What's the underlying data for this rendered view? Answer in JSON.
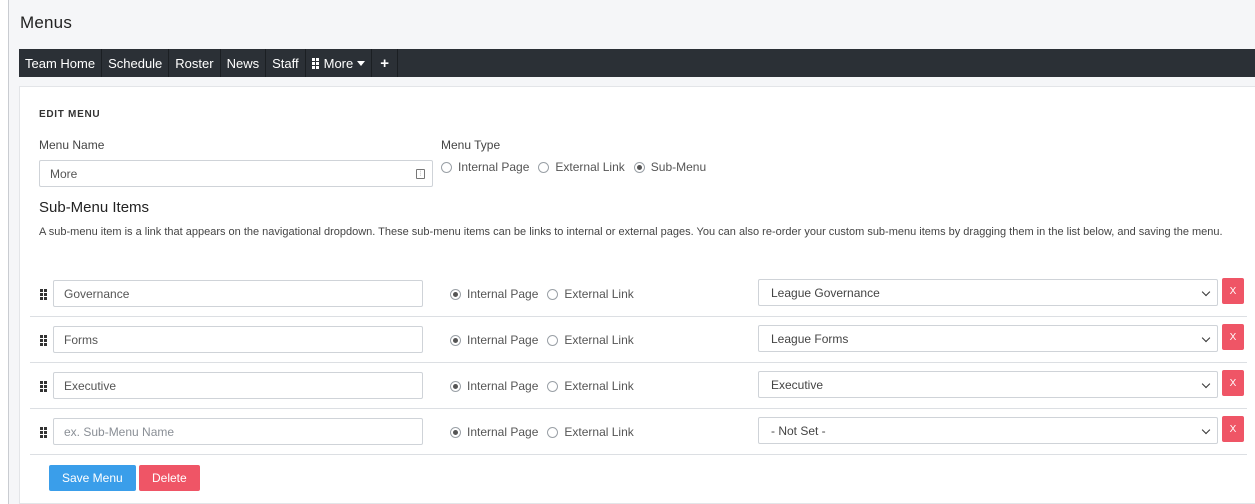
{
  "page_title": "Menus",
  "nav": {
    "items": [
      "Team Home",
      "Schedule",
      "Roster",
      "News",
      "Staff"
    ],
    "more_label": "More",
    "add_label": "+"
  },
  "edit": {
    "section_title": "EDIT MENU",
    "menu_name_label": "Menu Name",
    "menu_name_value": "More",
    "menu_type_label": "Menu Type",
    "type_options": [
      "Internal Page",
      "External Link",
      "Sub-Menu"
    ],
    "selected_type": "Sub-Menu"
  },
  "submenu": {
    "title": "Sub-Menu Items",
    "description": "A sub-menu item is a link that appears on the navigational dropdown. These sub-menu items can be links to internal or external pages. You can also re-order your custom sub-menu items by dragging them in the list below, and saving the menu.",
    "link_options": [
      "Internal Page",
      "External Link"
    ],
    "remove_label": "X",
    "items": [
      {
        "name": "Governance",
        "placeholder": "",
        "link_type": "Internal Page",
        "page": "League Governance"
      },
      {
        "name": "Forms",
        "placeholder": "",
        "link_type": "Internal Page",
        "page": "League Forms"
      },
      {
        "name": "Executive",
        "placeholder": "",
        "link_type": "Internal Page",
        "page": "Executive"
      },
      {
        "name": "",
        "placeholder": "ex. Sub-Menu Name",
        "link_type": "Internal Page",
        "page": "- Not Set -"
      }
    ]
  },
  "actions": {
    "save_label": "Save Menu",
    "delete_label": "Delete"
  },
  "colors": {
    "navbar": "#2b3036",
    "save_button": "#3a9eea",
    "delete_button": "#ef5566"
  }
}
